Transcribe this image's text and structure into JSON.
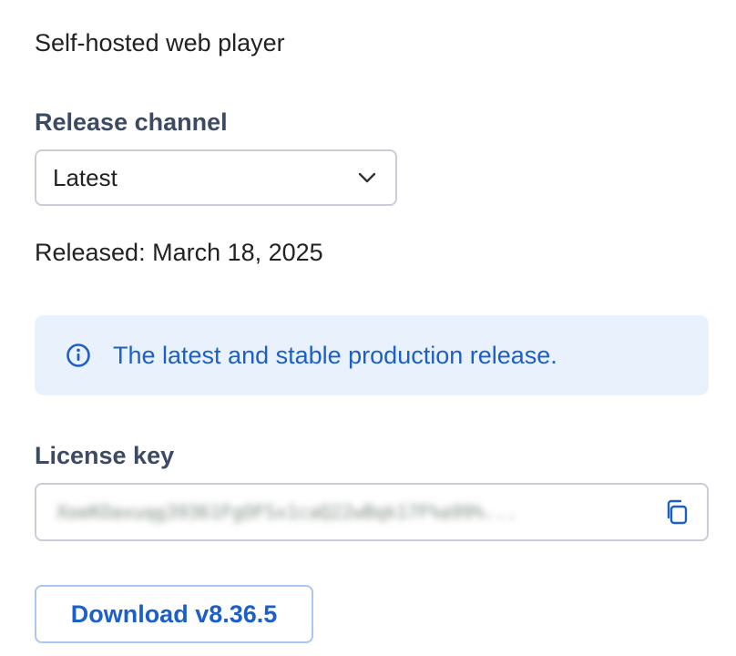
{
  "section": {
    "heading": "Self-hosted web player"
  },
  "release_channel": {
    "label": "Release channel",
    "selected": "Latest",
    "icon": "chevron-down-icon"
  },
  "released_text": "Released: March 18, 2025",
  "info_banner": {
    "icon": "info-icon",
    "text": "The latest and stable production release.",
    "color": "#1d5fc8",
    "background": "#e9f2fc"
  },
  "license": {
    "label": "License key",
    "value_obscured": "XoeKOaxuqg39361FgOFSx1caQ22wBqk17F%a99%...",
    "copy_icon": "copy-icon"
  },
  "download_button": {
    "label": "Download v8.36.5"
  }
}
